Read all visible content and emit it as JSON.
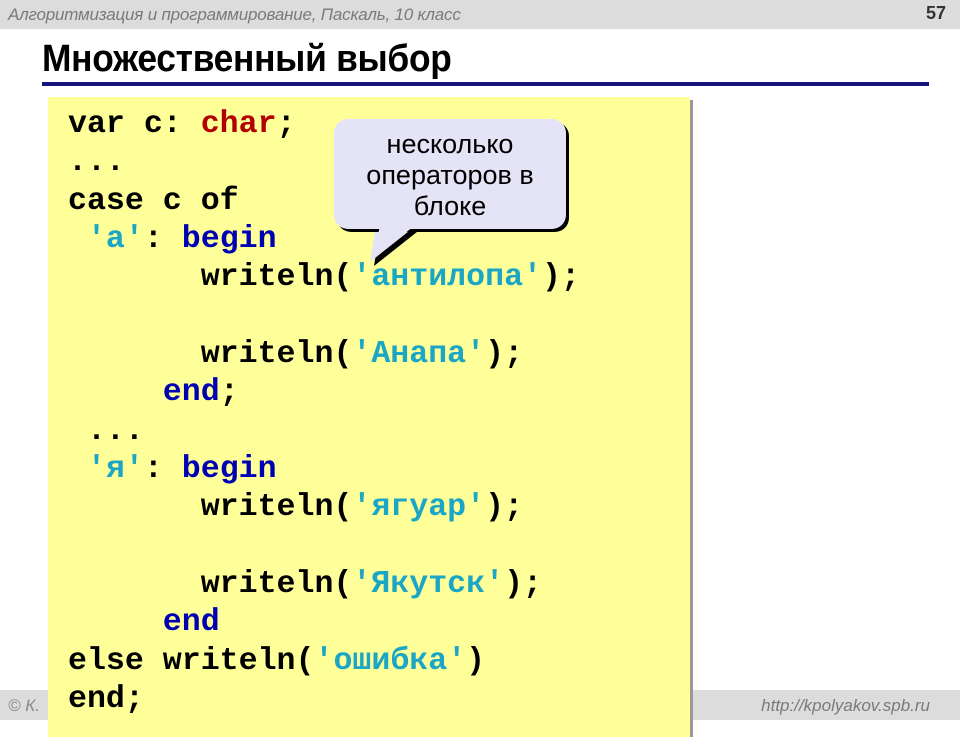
{
  "header": {
    "course_title": "Алгоритмизация и программирование, Паскаль, 10 класс",
    "page_number": "57"
  },
  "slide": {
    "title": "Множественный выбор"
  },
  "code": {
    "lines": [
      [
        {
          "t": "var c: "
        },
        {
          "t": "char",
          "c": "kw-type"
        },
        {
          "t": ";"
        }
      ],
      [
        {
          "t": "..."
        }
      ],
      [
        {
          "t": "case c of"
        }
      ],
      [
        {
          "t": " "
        },
        {
          "t": "'a'",
          "c": "str"
        },
        {
          "t": ": "
        },
        {
          "t": "begin",
          "c": "kw-blue"
        }
      ],
      [
        {
          "t": "       writeln("
        },
        {
          "t": "'антилопа'",
          "c": "str"
        },
        {
          "t": ");"
        }
      ],
      [
        {
          "t": ""
        }
      ],
      [
        {
          "t": "       writeln("
        },
        {
          "t": "'Анапа'",
          "c": "str"
        },
        {
          "t": ");"
        }
      ],
      [
        {
          "t": "     "
        },
        {
          "t": "end",
          "c": "kw-blue"
        },
        {
          "t": ";"
        }
      ],
      [
        {
          "t": " ..."
        }
      ],
      [
        {
          "t": " "
        },
        {
          "t": "'я'",
          "c": "str"
        },
        {
          "t": ": "
        },
        {
          "t": "begin",
          "c": "kw-blue"
        }
      ],
      [
        {
          "t": "       writeln("
        },
        {
          "t": "'ягуар'",
          "c": "str"
        },
        {
          "t": ");"
        }
      ],
      [
        {
          "t": ""
        }
      ],
      [
        {
          "t": "       writeln("
        },
        {
          "t": "'Якутск'",
          "c": "str"
        },
        {
          "t": ");"
        }
      ],
      [
        {
          "t": "     "
        },
        {
          "t": "end",
          "c": "kw-blue"
        }
      ],
      [
        {
          "t": "else writeln("
        },
        {
          "t": "'ошибка'",
          "c": "str"
        },
        {
          "t": ")"
        }
      ],
      [
        {
          "t": "end;"
        }
      ]
    ]
  },
  "callout": {
    "lines": [
      "несколько",
      "операторов в",
      "блоке"
    ]
  },
  "footer": {
    "left_visible": "© К.",
    "url": "http://kpolyakov.spb.ru"
  },
  "colors": {
    "code_background": "#ffff99",
    "type_keyword": "#b30000",
    "block_keyword": "#0000b3",
    "string_literal": "#1ca6c6",
    "title_rule": "#14147a",
    "callout_background": "#e4e4f6"
  }
}
